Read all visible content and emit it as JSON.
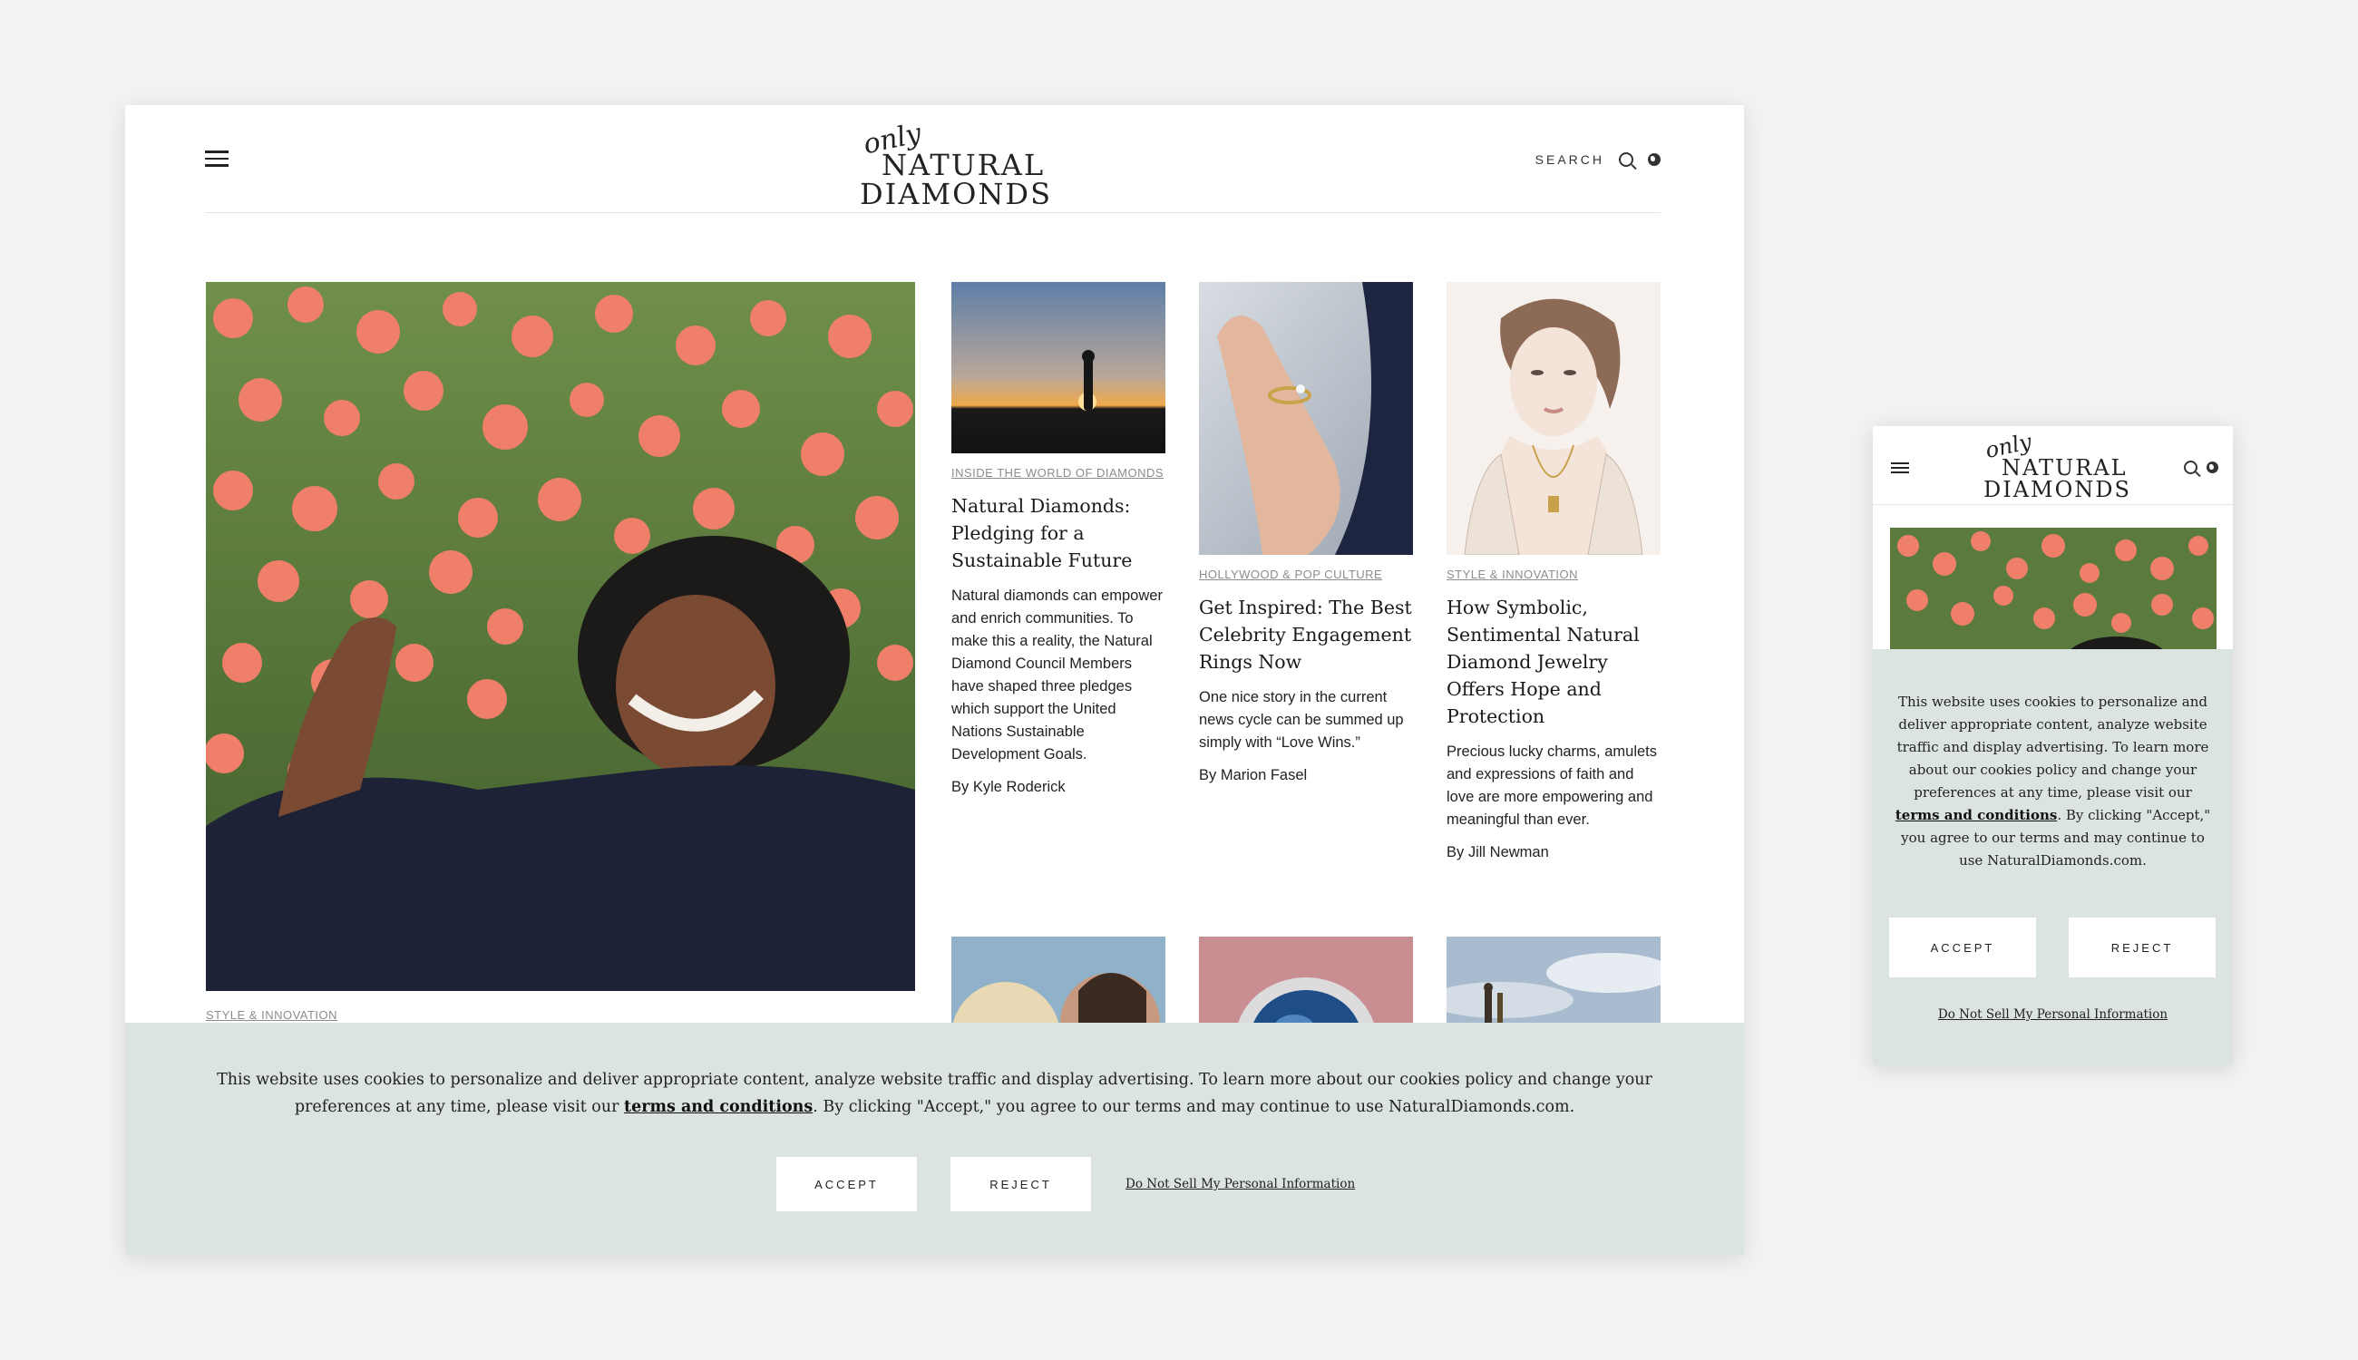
{
  "desktop": {
    "logo": {
      "top_word": "only",
      "line1": "NATURAL",
      "line2": "DIAMONDS"
    },
    "search_label": "SEARCH",
    "hero": {
      "category": "STYLE & INNOVATION"
    },
    "cards": [
      {
        "category": "INSIDE THE WORLD OF DIAMONDS",
        "title": "Natural Diamonds: Pledging for a Sustainable Future",
        "excerpt": "Natural diamonds can empower and enrich communities. To make this a reality, the Natural Diamond Council Members have shaped three pledges which support the United Nations Sustainable Development Goals.",
        "byline": "By Kyle Roderick"
      },
      {
        "category": "HOLLYWOOD & POP CULTURE",
        "title": "Get Inspired: The Best Celebrity Engagement Rings Now",
        "excerpt": "One nice story in the current news cycle can be summed up simply with “Love Wins.”",
        "byline": "By Marion Fasel"
      },
      {
        "category": "STYLE & INNOVATION",
        "title": "How Symbolic, Sentimental Natural Diamond Jewelry Offers Hope and Protection",
        "excerpt": "Precious lucky charms, amulets and expressions of faith and love are more empowering and meaningful than ever.",
        "byline": "By Jill Newman"
      }
    ],
    "cookie": {
      "text_before": "This website uses cookies to personalize and deliver appropriate content, analyze website traffic and display advertising. To learn more about our cookies policy and change your preferences at any time, please visit our ",
      "link": "terms and conditions",
      "text_after": ". By clicking \"Accept,\" you agree to our terms and may continue to use NaturalDiamonds.com.",
      "accept": "ACCEPT",
      "reject": "REJECT",
      "do_not_sell": "Do Not Sell My Personal Information"
    }
  },
  "mobile": {
    "logo": {
      "top_word": "only",
      "line1": "NATURAL",
      "line2": "DIAMONDS"
    },
    "cookie": {
      "text_before": "This website uses cookies to personalize and deliver appropriate content, analyze website traffic and display advertising. To learn more about our cookies policy and change your preferences at any time, please visit our ",
      "link": "terms and conditions",
      "text_after": ". By clicking \"Accept,\" you agree to our terms and may continue to use NaturalDiamonds.com.",
      "accept": "ACCEPT",
      "reject": "REJECT",
      "do_not_sell": "Do Not Sell My Personal Information"
    }
  },
  "colors": {
    "page_bg": "#f2f2f2",
    "cookie_banner_bg": "#dbe4e0",
    "text": "#222222",
    "category_text": "#8c8c8c"
  }
}
